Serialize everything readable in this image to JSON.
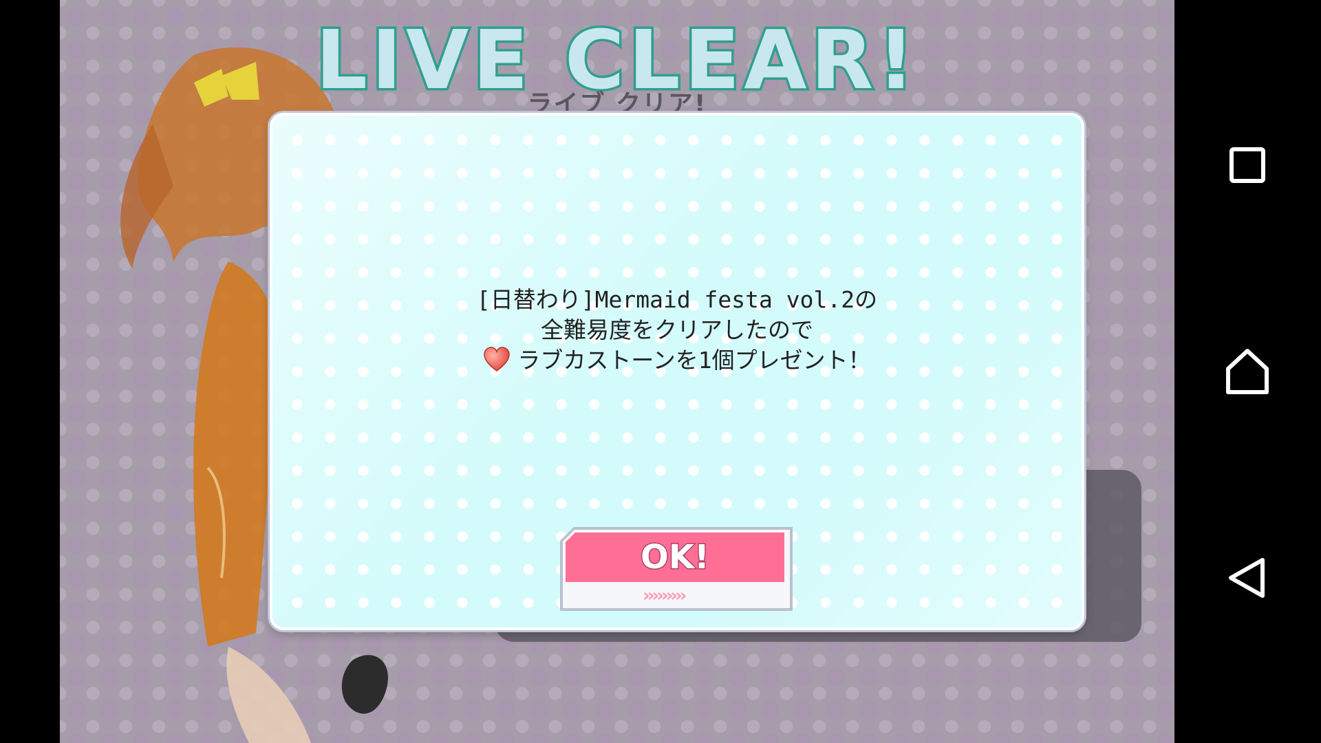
{
  "game": {
    "title": "LIVE CLEAR!",
    "subtitle": "ライブ クリア!",
    "dialog": {
      "lines": [
        "[日替わり]Mermaid festa vol.2の",
        "全難易度をクリアしたので",
        "ラブカストーン を1個プレゼント！"
      ],
      "line3_text": "ラブカストーンを1個プレゼント！",
      "reward_icon": "heart-icon",
      "ok_label": "OK!",
      "ok_chevrons": "›››››››››"
    }
  },
  "navbar": {
    "recents_icon": "square-icon",
    "home_icon": "home-icon",
    "back_icon": "back-triangle-icon"
  },
  "colors": {
    "dialog_bg": "#d4fbfb",
    "ok_button": "#ff6e95",
    "title_fill": "#c9e7ee",
    "title_stroke": "#2f9f8f"
  }
}
